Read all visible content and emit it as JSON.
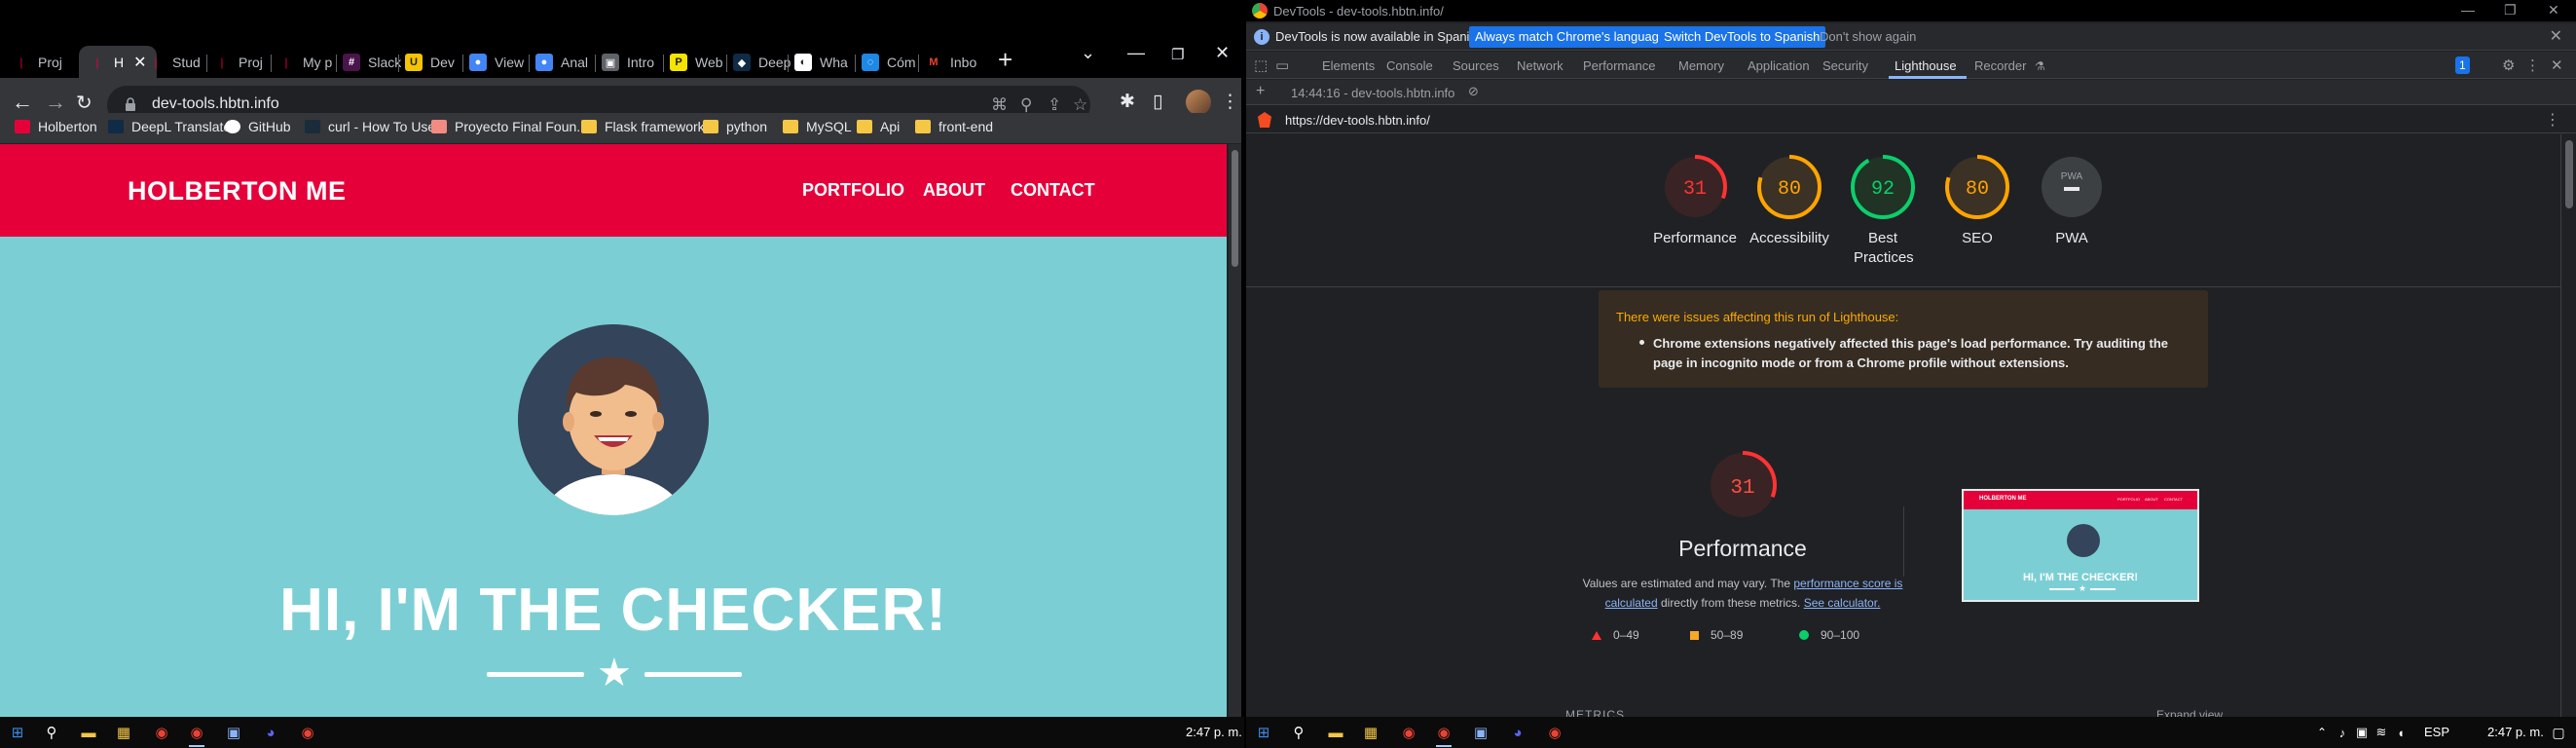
{
  "browser": {
    "tabs": [
      {
        "label": "Proj",
        "color": "#e5003a",
        "glyph": "❘"
      },
      {
        "label": "H",
        "color": "#e5003a",
        "glyph": "❘",
        "active": true
      },
      {
        "label": "Stud",
        "color": "#e5003a",
        "glyph": "❘"
      },
      {
        "label": "Proj",
        "color": "#e5003a",
        "glyph": "❘"
      },
      {
        "label": "My p",
        "color": "#e5003a",
        "glyph": "❘"
      },
      {
        "label": "Slack",
        "color": "#4a154b",
        "glyph": "#"
      },
      {
        "label": "Dev",
        "color": "#f5c400",
        "glyph": "U"
      },
      {
        "label": "View",
        "color": "#4285f4",
        "glyph": "●"
      },
      {
        "label": "Anal",
        "color": "#4285f4",
        "glyph": "●"
      },
      {
        "label": "Intro",
        "color": "#5f6368",
        "glyph": "▣"
      },
      {
        "label": "Web",
        "color": "#f5e400",
        "glyph": "P"
      },
      {
        "label": "Deep",
        "color": "#0f2b46",
        "glyph": "◆"
      },
      {
        "label": "Wha",
        "color": "#ffffff",
        "glyph": "◐"
      },
      {
        "label": "Cóm",
        "color": "#1e88e5",
        "glyph": "◌"
      },
      {
        "label": "Inbo",
        "color": "#ea4335",
        "glyph": "M"
      }
    ],
    "url": "dev-tools.hbtn.info",
    "bookmarks": [
      {
        "label": "Holberton",
        "kind": "site"
      },
      {
        "label": "DeepL Translate",
        "kind": "deepl"
      },
      {
        "label": "GitHub",
        "kind": "github"
      },
      {
        "label": "curl - How To Use",
        "kind": "curl"
      },
      {
        "label": "Proyecto Final Foun...",
        "kind": "doc"
      },
      {
        "label": "Flask framework",
        "kind": "folder"
      },
      {
        "label": "python",
        "kind": "folder"
      },
      {
        "label": "MySQL",
        "kind": "folder"
      },
      {
        "label": "Api",
        "kind": "folder"
      },
      {
        "label": "front-end",
        "kind": "folder"
      }
    ]
  },
  "site": {
    "logo": "HOLBERTON ME",
    "nav": [
      "PORTFOLIO",
      "ABOUT",
      "CONTACT"
    ],
    "hero_title": "HI, I'M THE CHECKER!"
  },
  "devtools": {
    "window_title": "DevTools - dev-tools.hbtn.info/",
    "infobar": {
      "message": "DevTools is now available in Spanish!",
      "btn_match": "Always match Chrome's language",
      "btn_switch": "Switch DevTools to Spanish",
      "btn_dismiss": "Don't show again"
    },
    "tabs": [
      "Elements",
      "Console",
      "Sources",
      "Network",
      "Performance",
      "Memory",
      "Application",
      "Security",
      "Lighthouse",
      "Recorder"
    ],
    "active_tab": "Lighthouse",
    "issues_badge": "1",
    "report_time": "14:44:16 - dev-tools.hbtn.info",
    "report_url": "https://dev-tools.hbtn.info/",
    "scores": [
      {
        "label": "Performance",
        "value": 31,
        "color": "#ff3333",
        "bg": "#3a2324"
      },
      {
        "label": "Accessibility",
        "value": 80,
        "color": "#ffa400",
        "bg": "#3b3125"
      },
      {
        "label": "Best Practices",
        "value": 92,
        "color": "#0cce6b",
        "bg": "#203325"
      },
      {
        "label": "SEO",
        "value": 80,
        "color": "#ffa400",
        "bg": "#3b3125"
      },
      {
        "label": "PWA",
        "value": null,
        "color": "#9aa0a6",
        "bg": "#3c4043"
      }
    ],
    "pwa_badge": "PWA",
    "warning": {
      "title": "There were issues affecting this run of Lighthouse:",
      "item": "Chrome extensions negatively affected this page's load performance. Try auditing the page in incognito mode or from a Chrome profile without extensions."
    },
    "perf": {
      "score": "31",
      "title": "Performance",
      "desc_1": "Values are estimated and may vary. The ",
      "link_1": "performance score is calculated",
      "desc_2": " directly from these metrics. ",
      "link_2": "See calculator."
    },
    "legend": [
      "0–49",
      "50–89",
      "90–100"
    ],
    "thumb": {
      "logo": "HOLBERTON ME",
      "links": [
        "PORTFOLIO",
        "ABOUT",
        "CONTACT"
      ],
      "title": "HI, I'M THE CHECKER!"
    },
    "metrics_label": "METRICS",
    "expand_label": "Expand view"
  },
  "taskbar": {
    "left_time": "2:47 p. m.",
    "right_time": "2:47 p. m.",
    "lang": "ESP"
  }
}
